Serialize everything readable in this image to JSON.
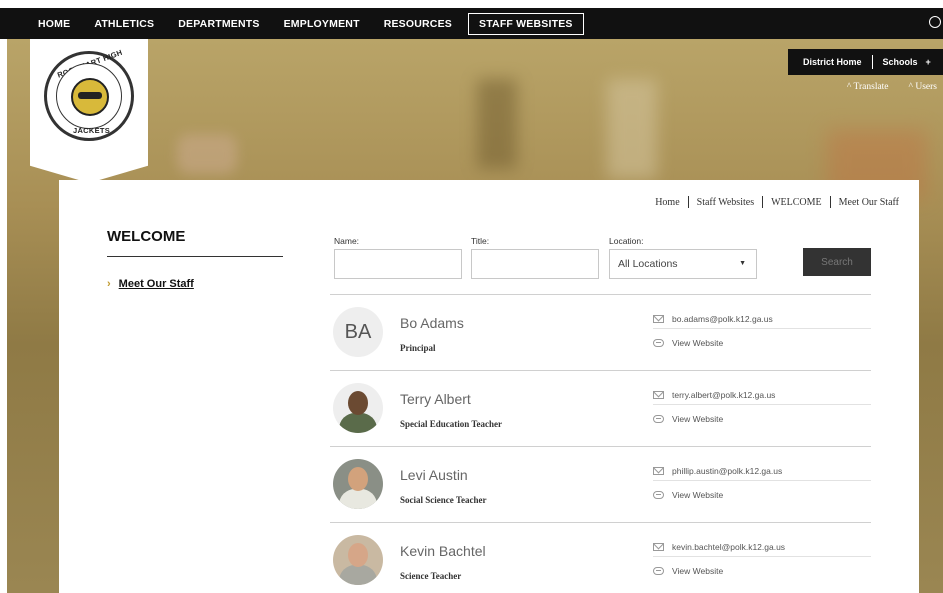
{
  "topnav": {
    "items": [
      "HOME",
      "ATHLETICS",
      "DEPARTMENTS",
      "EMPLOYMENT",
      "RESOURCES",
      "STAFF WEBSITES"
    ]
  },
  "logo": {
    "line1": "ROCKMART HIGH SCHOOL",
    "line2": "JACKETS"
  },
  "district": {
    "home": "District Home",
    "schools": "Schools",
    "schools_icon": "+",
    "translate": "^ Translate",
    "users": "^ Users"
  },
  "breadcrumb": [
    "Home",
    "Staff Websites",
    "WELCOME",
    "Meet Our Staff"
  ],
  "sidebar": {
    "title": "WELCOME",
    "chevron": "›",
    "link": "Meet Our Staff"
  },
  "filters": {
    "name_label": "Name:",
    "title_label": "Title:",
    "location_label": "Location:",
    "location_value": "All Locations",
    "location_arrow": "▼",
    "search_label": "Search"
  },
  "staff": [
    {
      "initials": "BA",
      "name": "Bo Adams",
      "title": "Principal",
      "email": "bo.adams@polk.k12.ga.us",
      "website": "View Website"
    },
    {
      "initials": "",
      "name": "Terry Albert",
      "title": "Special Education Teacher",
      "email": "terry.albert@polk.k12.ga.us",
      "website": "View Website"
    },
    {
      "initials": "",
      "name": "Levi Austin",
      "title": "Social Science Teacher",
      "email": "phillip.austin@polk.k12.ga.us",
      "website": "View Website"
    },
    {
      "initials": "",
      "name": "Kevin Bachtel",
      "title": "Science Teacher",
      "email": "kevin.bachtel@polk.k12.ga.us",
      "website": "View Website"
    }
  ]
}
